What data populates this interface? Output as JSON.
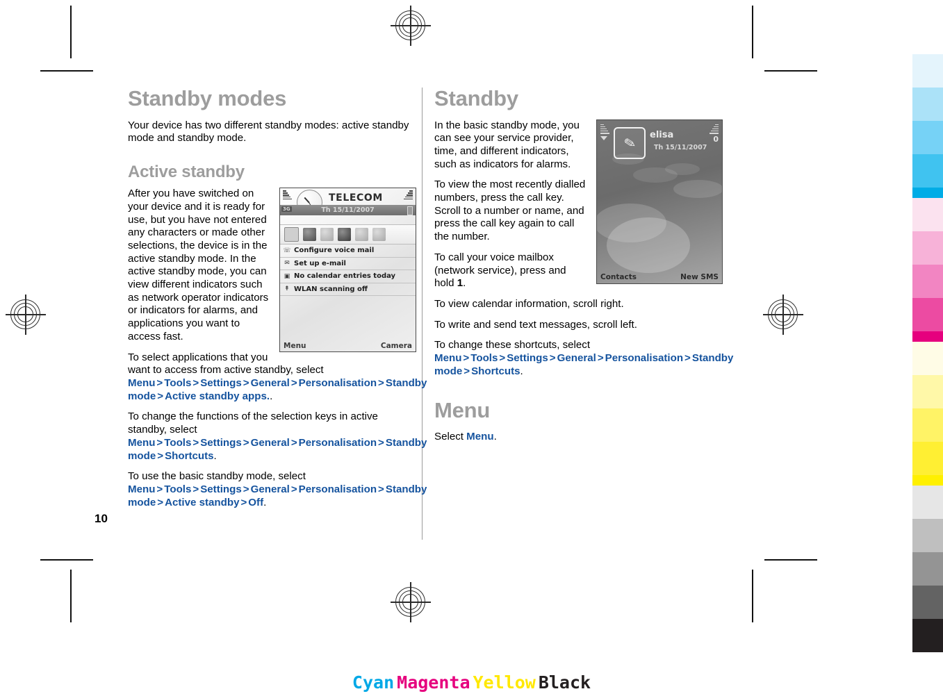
{
  "document": {
    "page_number": "10",
    "color_bar_label": [
      "Cyan",
      "Magenta",
      "Yellow",
      "Black"
    ],
    "color_bar_colors": [
      "#00a8e6",
      "#e6007e",
      "#ffe800",
      "#231f20"
    ]
  },
  "left_column": {
    "heading": "Standby modes",
    "intro": "Your device has two different standby modes: active standby mode and standby mode.",
    "subheading": "Active standby",
    "para_1": "After you have switched on your device and it is ready for use, but you have not entered any characters or made other selections, the device is in the active standby mode. In the active standby mode, you can view different indicators such as network operator indicators or indicators for alarms, and applications you want to access fast.",
    "para_2_prefix": "To select applications that you want to access from active standby, select ",
    "para_2_path": [
      "Menu",
      "Tools",
      "Settings",
      "General",
      "Personalisation",
      "Standby mode",
      "Active standby apps."
    ],
    "para_2_suffix": ".",
    "para_3_prefix": "To change the functions of the selection keys in active standby, select ",
    "para_3_path": [
      "Menu",
      "Tools",
      "Settings",
      "General",
      "Personalisation",
      "Standby mode",
      "Shortcuts"
    ],
    "para_3_suffix": ".",
    "para_4_prefix": "To use the basic standby mode, select ",
    "para_4_path": [
      "Menu",
      "Tools",
      "Settings",
      "General",
      "Personalisation",
      "Standby mode",
      "Active standby",
      "Off"
    ],
    "para_4_suffix": "."
  },
  "right_column": {
    "heading": "Standby",
    "para_1": "In the basic standby mode, you can see your service provider, time, and different indicators, such as indicators for alarms.",
    "para_2": "To view the most recently dialled numbers, press the call key. Scroll to a number or name, and press the call key again to call the number.",
    "para_3_prefix": "To call your voice mailbox (network service), press and hold ",
    "para_3_bold": "1",
    "para_3_suffix": ".",
    "para_4": "To view calendar information, scroll right.",
    "para_5": "To write and send text messages, scroll left.",
    "para_6_prefix": "To change these shortcuts, select ",
    "para_6_path": [
      "Menu",
      "Tools",
      "Settings",
      "General",
      "Personalisation",
      "Standby mode",
      "Shortcuts"
    ],
    "para_6_suffix": ".",
    "heading_2": "Menu",
    "para_7_prefix": "Select ",
    "para_7_link": "Menu",
    "para_7_suffix": "."
  },
  "screenshot_active_standby": {
    "operator": "TELECOM",
    "date": "Th 15/11/2007",
    "network_badge": "3G",
    "list_items": [
      {
        "icon": "voicemail-icon",
        "label": "Configure voice mail"
      },
      {
        "icon": "email-icon",
        "label": "Set up e-mail"
      },
      {
        "icon": "calendar-icon",
        "label": "No calendar entries today"
      },
      {
        "icon": "wlan-icon",
        "label": "WLAN scanning off"
      }
    ],
    "softkey_left": "Menu",
    "softkey_right": "Camera"
  },
  "screenshot_basic_standby": {
    "operator": "elisa",
    "date": "Th 15/11/2007",
    "battery_indicator": "0",
    "softkey_left": "Contacts",
    "softkey_right": "New SMS"
  },
  "swatches": {
    "cyan": [
      "#e4f4fc",
      "#abe2f8",
      "#76d2f6",
      "#40c3f0",
      "#00ace6"
    ],
    "magenta": [
      "#fbe2ef",
      "#f7b2d8",
      "#f285c2",
      "#ec4ba2",
      "#e6007e"
    ],
    "yellow": [
      "#fffce6",
      "#fff8a8",
      "#fff366",
      "#ffef33",
      "#fff000"
    ],
    "black": [
      "#e6e6e6",
      "#bfbfbf",
      "#949494",
      "#636363",
      "#231f20"
    ]
  }
}
